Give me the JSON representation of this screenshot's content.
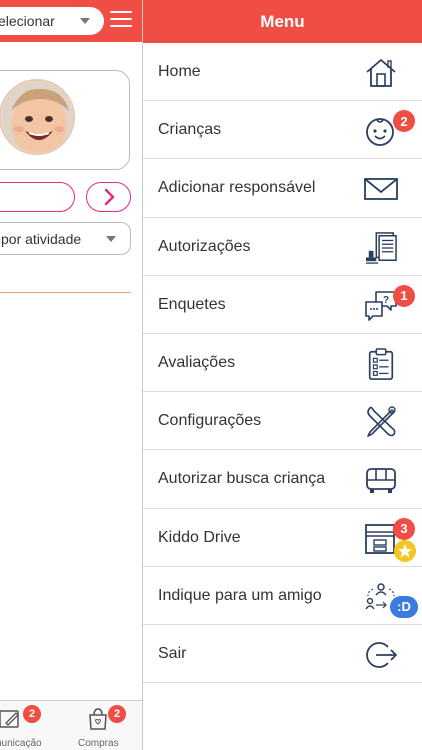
{
  "left": {
    "child_select": "elecionar",
    "activity_select": "por atividade",
    "tabs": [
      {
        "label": "nunicação",
        "badge": "2",
        "icon": "message-edit-icon"
      },
      {
        "label": "Compras",
        "badge": "2",
        "icon": "shopping-bag-icon"
      }
    ]
  },
  "menu": {
    "title": "Menu",
    "items": [
      {
        "label": "Home",
        "icon": "home-icon"
      },
      {
        "label": "Crianças",
        "icon": "baby-face-icon",
        "badge": "2"
      },
      {
        "label": "Adicionar responsável",
        "icon": "envelope-icon"
      },
      {
        "label": "Autorizações",
        "icon": "stamp-document-icon"
      },
      {
        "label": "Enquetes",
        "icon": "question-chat-icon",
        "badge": "1"
      },
      {
        "label": "Avaliações",
        "icon": "clipboard-checklist-icon"
      },
      {
        "label": "Configurações",
        "icon": "tools-icon"
      },
      {
        "label": "Autorizar busca criança",
        "icon": "bus-icon"
      },
      {
        "label": "Kiddo Drive",
        "icon": "archive-box-icon",
        "badge": "3"
      },
      {
        "label": "Indique para um amigo",
        "icon": "share-people-icon",
        "smiley_badge": ":D"
      },
      {
        "label": "Sair",
        "icon": "logout-icon"
      }
    ]
  },
  "colors": {
    "accent": "#f04e44",
    "pink": "#e02a8a",
    "icon_blue": "#2a3f5f"
  }
}
